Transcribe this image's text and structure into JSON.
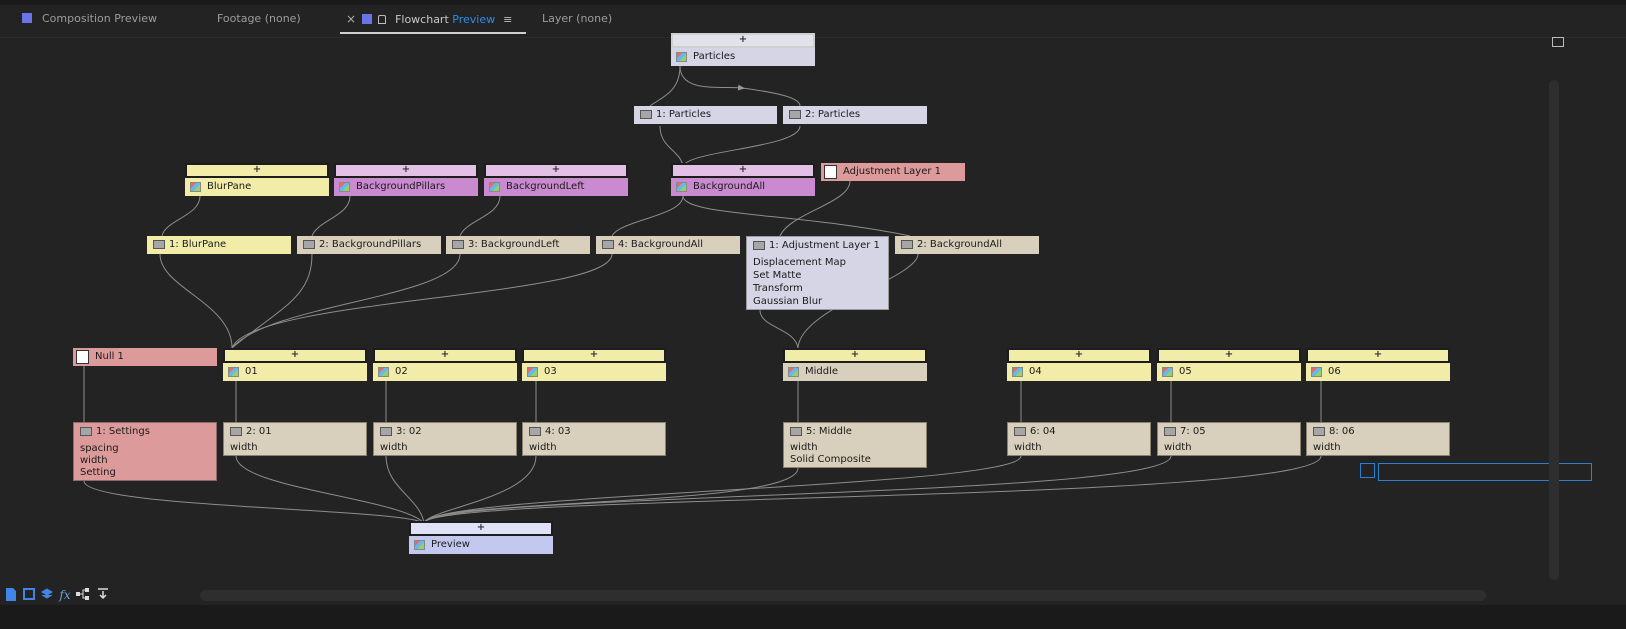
{
  "tabs": [
    {
      "label": "Composition Preview",
      "active": false
    },
    {
      "label": "Footage (none)",
      "active": false
    },
    {
      "label": "Flowchart",
      "accent": "Preview",
      "active": true
    },
    {
      "label": "Layer (none)",
      "active": false
    }
  ],
  "tab_close_glyph": "×",
  "tab_menu_glyph": "≡",
  "nodes": {
    "particles_comp": "Particles",
    "layer_particles_1": "1: Particles",
    "layer_particles_2": "2: Particles",
    "blurpane_comp": "BlurPane",
    "bgpillars_comp": "BackgroundPillars",
    "bgleft_comp": "BackgroundLeft",
    "bgall_comp": "BackgroundAll",
    "adjustment_solid": "Adjustment Layer 1",
    "layer_blurpane": "1: BlurPane",
    "layer_bgpillars": "2: BackgroundPillars",
    "layer_bgleft": "3: BackgroundLeft",
    "layer_bgall_4": "4: BackgroundAll",
    "layer_adjust": "1: Adjustment Layer 1",
    "layer_adjust_fx": [
      "Displacement Map",
      "Set Matte",
      "Transform",
      "Gaussian Blur"
    ],
    "layer_bgall_2": "2: BackgroundAll",
    "null_solid": "Null 1",
    "comp_01": "01",
    "comp_02": "02",
    "comp_03": "03",
    "comp_middle": "Middle",
    "comp_04": "04",
    "comp_05": "05",
    "comp_06": "06",
    "layer_settings": "1: Settings",
    "layer_settings_fx": [
      "spacing",
      "width",
      "Setting"
    ],
    "layer_01": "2: 01",
    "layer_02": "3: 02",
    "layer_03": "4: 03",
    "layer_middle": "5: Middle",
    "layer_middle_fx": [
      "width",
      "Solid Composite"
    ],
    "layer_04": "6: 04",
    "layer_05": "7: 05",
    "layer_06": "8: 06",
    "fx_width": "width",
    "preview_comp": "Preview"
  },
  "plus_glyph": "+",
  "colors": {
    "yellow": "#f1eca8",
    "purple": "#c98ad0",
    "lavender": "#d5d5e6",
    "tan": "#d8d0bd",
    "pink": "#dc9a9a",
    "blue": "#c3c8ef",
    "tab_accent": "#2d8ceb",
    "tab_square": "#6b74e6"
  },
  "bottom_icons": [
    "comp-page-icon",
    "square-icon",
    "layers-icon",
    "fx-icon",
    "flowchart-icon",
    "collapse-icon"
  ]
}
